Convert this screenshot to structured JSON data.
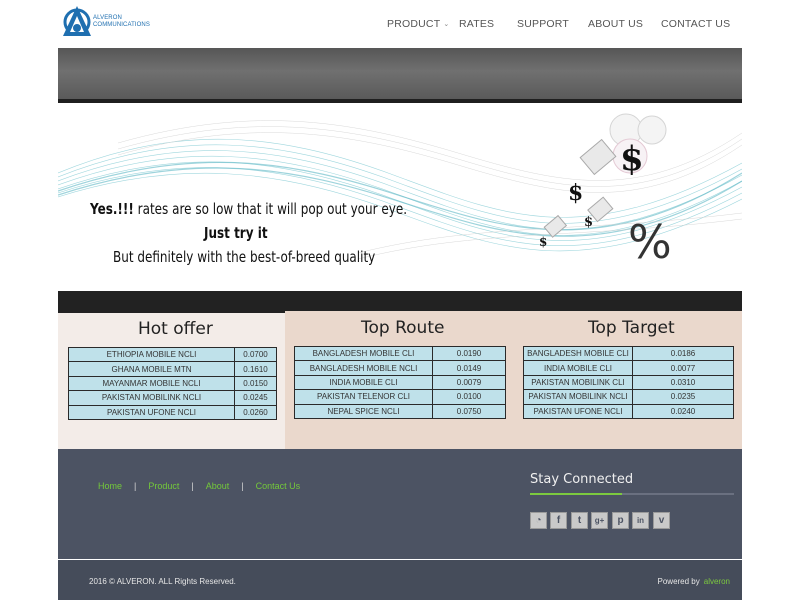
{
  "brand": {
    "logo_line1": "ALVERON",
    "logo_line2": "COMMUNICATIONS",
    "accent_color": "#1f6fb0"
  },
  "nav": {
    "items": [
      {
        "label": "PRODUCT",
        "has_dropdown": true
      },
      {
        "label": "RATES"
      },
      {
        "label": "SUPPORT"
      },
      {
        "label": "ABOUT US"
      },
      {
        "label": "CONTACT US"
      }
    ]
  },
  "banner": {
    "line1_bold": "Yes.!!!",
    "line1_rest": " rates are so low that it will pop out your eye.",
    "line2": "Just try it",
    "line3": "But definitely with the best-of-breed quality",
    "icons": [
      "dollar-icon",
      "envelope-icon",
      "percent-icon"
    ]
  },
  "hot_offer": {
    "title": "Hot offer",
    "rows": [
      {
        "route": "ETHIOPIA MOBILE NCLI",
        "rate": "0.0700"
      },
      {
        "route": "GHANA MOBILE MTN",
        "rate": "0.1610"
      },
      {
        "route": "MAYANMAR MOBILE NCLI",
        "rate": "0.0150"
      },
      {
        "route": "PAKISTAN MOBILINK NCLI",
        "rate": "0.0245"
      },
      {
        "route": "PAKISTAN UFONE NCLI",
        "rate": "0.0260"
      }
    ]
  },
  "top_route": {
    "title": "Top Route",
    "rows": [
      {
        "route": "BANGLADESH MOBILE CLI",
        "rate": "0.0190"
      },
      {
        "route": "BANGLADESH MOBILE NCLI",
        "rate": "0.0149"
      },
      {
        "route": "INDIA MOBILE CLI",
        "rate": "0.0079"
      },
      {
        "route": "PAKISTAN TELENOR CLI",
        "rate": "0.0100"
      },
      {
        "route": "NEPAL SPICE NCLI",
        "rate": "0.0750"
      }
    ]
  },
  "top_target": {
    "title": "Top Target",
    "rows": [
      {
        "route": "BANGLADESH MOBILE CLI",
        "rate": "0.0186"
      },
      {
        "route": "INDIA MOBILE CLI",
        "rate": "0.0077"
      },
      {
        "route": "PAKISTAN MOBILINK CLI",
        "rate": "0.0310"
      },
      {
        "route": "PAKISTAN MOBILINK NCLI",
        "rate": "0.0235"
      },
      {
        "route": "PAKISTAN UFONE NCLI",
        "rate": "0.0240"
      }
    ]
  },
  "footer": {
    "links": [
      "Home",
      "Product",
      "About",
      "Contact Us"
    ],
    "link_color": "#74c93a",
    "stay_connected": "Stay Connected",
    "social": [
      "rss-icon",
      "facebook-icon",
      "twitter-icon",
      "google-plus-icon",
      "pinterest-icon",
      "linkedin-icon",
      "vimeo-icon"
    ],
    "social_glyphs": [
      "◔",
      "f",
      "t",
      "g+",
      "p",
      "in",
      "v"
    ],
    "copyright": "2016 © ALVERON. ALL Rights Reserved.",
    "powered_label": "Powered by",
    "powered_brand": "alveron"
  }
}
